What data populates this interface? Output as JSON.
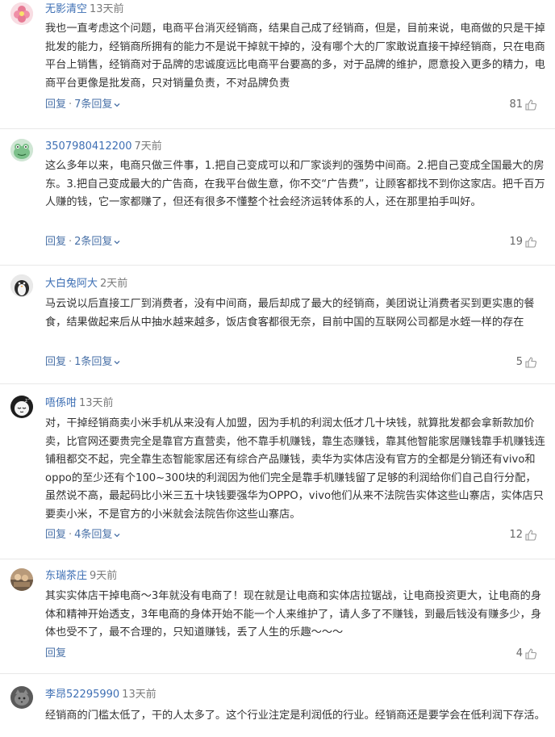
{
  "comments": [
    {
      "user": "无影清空",
      "time": "13天前",
      "text": "我也一直考虑这个问题，电商平台消灭经销商，结果自己成了经销商，但是，目前来说，电商做的只是干掉批发的能力，经销商所拥有的能力不是说干掉就干掉的，没有哪个大的厂家敢说直接干掉经销商，只在电商平台上销售，经销商对于品牌的忠诚度远比电商平台要高的多，对于品牌的维护，愿意投入更多的精力，电商平台更像是批发商，只对销量负责，不对品牌负责",
      "reply": "回复",
      "replies": "7条回复",
      "likes": "81",
      "avatar": "pink-flower-avatar"
    },
    {
      "user": "3507980412200",
      "time": "7天前",
      "text": "这么多年以来，电商只做三件事，1.把自己变成可以和厂家谈判的强势中间商。2.把自己变成全国最大的房东。3.把自己变成最大的广告商，在我平台做生意，你不交“广告费”，让顾客都找不到你这家店。把千百万人赚的钱，它一家都赚了，但还有很多不懂整个社会经济运转体系的人，还在那里拍手叫好。",
      "reply": "回复",
      "replies": "2条回复",
      "likes": "19",
      "avatar": "green-frog-avatar"
    },
    {
      "user": "大白兔阿大",
      "time": "2天前",
      "text": "马云说以后直接工厂到消费者，没有中间商，最后却成了最大的经销商，美团说让消费者买到更实惠的餐食，结果做起来后从中抽水越来越多，饭店食客都很无奈，目前中国的互联网公司都是水蛭一样的存在",
      "reply": "回复",
      "replies": "1条回复",
      "likes": "5",
      "avatar": "penguin-avatar"
    },
    {
      "user": "唔係咁",
      "time": "13天前",
      "text": "对，干掉经销商卖小米手机从来没有人加盟，因为手机的利润太低才几十块钱，就算批发都会拿新款加价卖，比官网还要贵完全是靠官方直营卖，他不靠手机赚钱，靠生态赚钱，靠其他智能家居赚钱靠手机赚钱连铺租都交不起，完全靠生态智能家居还有综合产品赚钱，卖华为实体店没有官方的全都是分销还有vivo和oppo的至少还有个100~300块的利润因为他们完全是靠手机赚钱留了足够的利润给你们自己自行分配，虽然说不高，最起码比小米三五十块钱要强华为OPPO，vivo他们从来不法院告实体这些山寨店，实体店只要卖小米，不是官方的小米就会法院告你这些山寨店。",
      "reply": "回复",
      "replies": "4条回复",
      "likes": "12",
      "avatar": "sleepy-face-avatar"
    },
    {
      "user": "东瑞茶庄",
      "time": "9天前",
      "text": "其实实体店干掉电商～3年就没有电商了！现在就是让电商和实体店拉锯战，让电商投资更大，让电商的身体和精神开始透支，3年电商的身体开始不能一个人来维护了，请人多了不赚钱，到最后钱没有赚多少，身体也受不了，最不合理的，只知道赚钱，丢了人生的乐趣～～～",
      "reply": "回复",
      "replies": "",
      "likes": "4",
      "avatar": "tea-shop-avatar"
    },
    {
      "user": "李昂52295990",
      "time": "13天前",
      "text": "经销商的门槛太低了，干的人太多了。这个行业注定是利润低的行业。经销商还是要学会在低利润下存活。",
      "reply": "",
      "replies": "",
      "likes": "",
      "avatar": "cat-avatar"
    }
  ],
  "icons": {
    "like": "thumbs-up-icon",
    "expand": "chevron-down-icon"
  },
  "colors": {
    "username": "#3e6fb4",
    "link": "#4a72a8",
    "text": "#333333",
    "muted": "#7a7a7a"
  }
}
